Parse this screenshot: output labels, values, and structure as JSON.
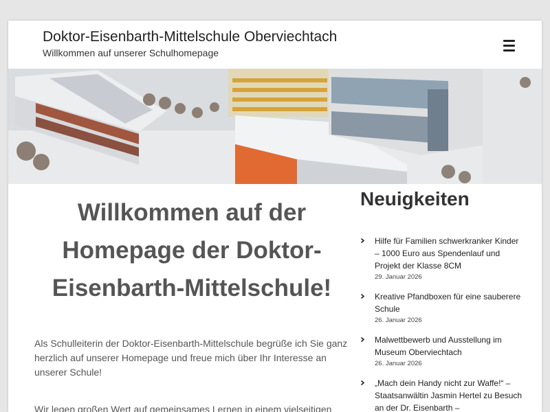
{
  "header": {
    "site_title": "Doktor-Eisenbarth-Mittelschule Oberviechtach",
    "tagline": "Willkommen auf unserer Schulhomepage",
    "menu_icon": "hamburger-menu-icon"
  },
  "hero": {
    "image": "school-building-aerial-winter-photo"
  },
  "main": {
    "heading": "Willkommen auf der Homepage der Doktor-Eisenbarth-Mittelschule!",
    "paragraph_1": "Als Schulleiterin der Doktor-Eisenbarth-Mittelschule begrüße ich Sie ganz herzlich auf unserer Homepage und freue mich über Ihr Interesse an unserer Schule!",
    "paragraph_2": "Wir legen großen Wert auf gemeinsames Lernen in einem vielseitigen"
  },
  "sidebar": {
    "heading": "Neuigkeiten",
    "news": [
      {
        "title": "Hilfe für Familien schwerkranker Kinder – 1000 Euro aus Spendenlauf und Projekt der Klasse 8CM",
        "date": "29. Januar 2026"
      },
      {
        "title": "Kreative Pfandboxen für eine sauberere Schule",
        "date": "26. Januar 2026"
      },
      {
        "title": "Malwettbewerb und Ausstellung im Museum Oberviechtach",
        "date": "26. Januar 2026"
      },
      {
        "title": "„Mach dein Handy nicht zur Waffe!“ – Staatsanwältin Jasmin Hertel zu Besuch an der Dr. Eisenbarth –",
        "date": ""
      }
    ]
  },
  "colors": {
    "page_background": "#e6e6e6",
    "content_background": "#ffffff",
    "heading_gray": "#555555",
    "text_dark": "#222222"
  }
}
